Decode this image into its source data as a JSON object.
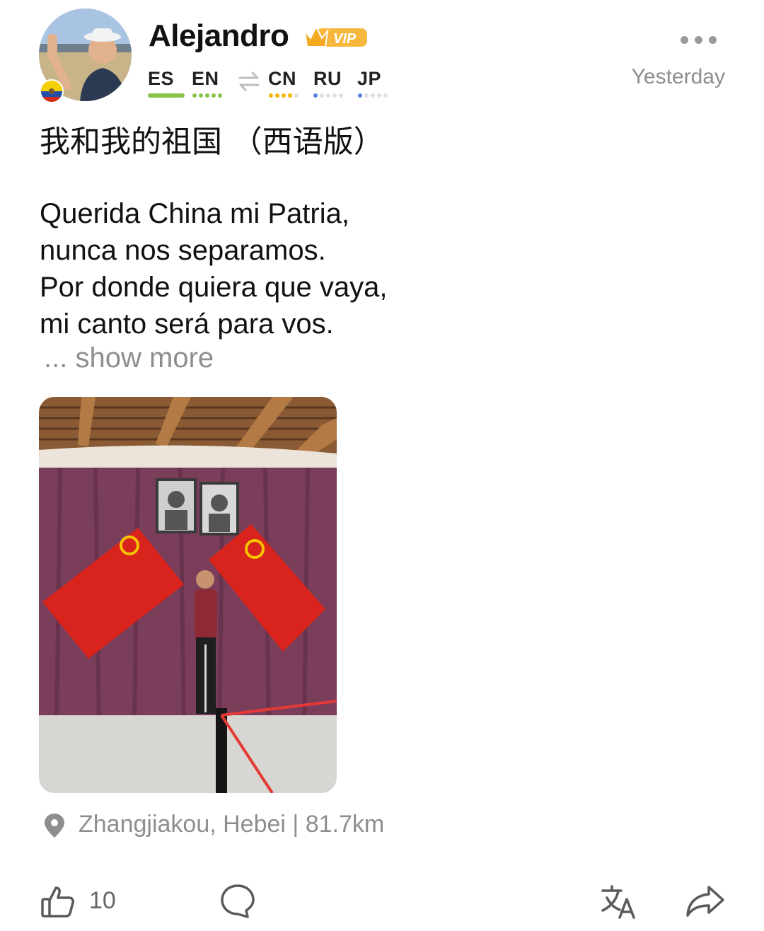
{
  "post": {
    "username": "Alejandro",
    "badge": "VIP",
    "timestamp": "Yesterday",
    "title": "我和我的祖国 （西语版）",
    "lines": [
      "Querida China mi Patria,",
      "nunca nos separamos.",
      "Por donde quiera que vaya,",
      "mi canto será para vos."
    ],
    "show_more": "... show more",
    "location": "Zhangjiakou, Hebei  |  81.7km",
    "like_count": "10"
  },
  "languages": {
    "native": [
      {
        "code": "ES",
        "level": "native",
        "color": "#8bc34a"
      },
      {
        "code": "EN",
        "level": 5,
        "max": 5,
        "color": "#8bc34a"
      }
    ],
    "learning": [
      {
        "code": "CN",
        "level": 4,
        "max": 5,
        "color": "#f4b400"
      },
      {
        "code": "RU",
        "level": 1,
        "max": 5,
        "color": "#5b7fe0"
      },
      {
        "code": "JP",
        "level": 1,
        "max": 5,
        "color": "#5b7fe0"
      }
    ]
  },
  "icons": {
    "more": "more-horizontal-icon",
    "swap": "swap-arrows-icon",
    "location": "location-pin-icon",
    "like": "thumbs-up-icon",
    "comment": "comment-bubble-icon",
    "translate": "translate-icon",
    "share": "share-arrow-icon"
  }
}
